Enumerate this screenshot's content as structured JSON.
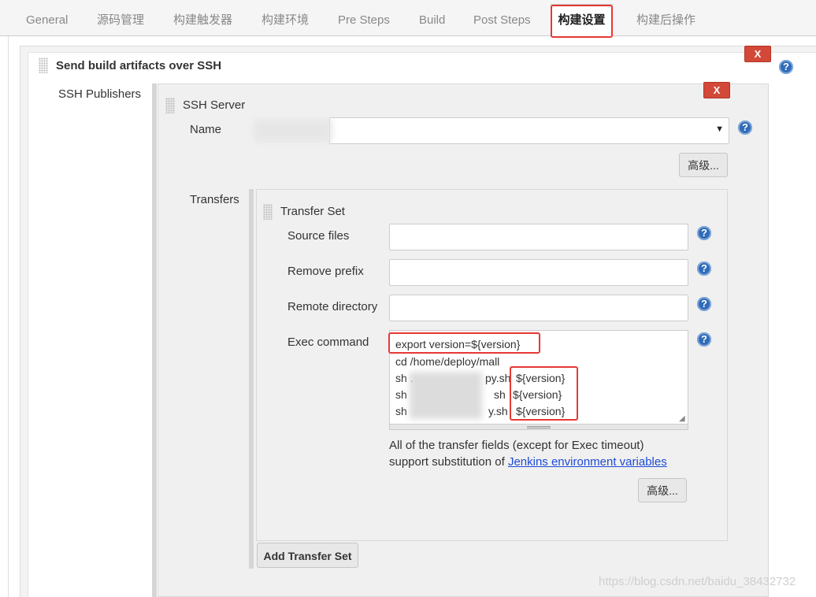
{
  "tabs": [
    {
      "label": "General"
    },
    {
      "label": "源码管理"
    },
    {
      "label": "构建触发器"
    },
    {
      "label": "构建环境"
    },
    {
      "label": "Pre Steps"
    },
    {
      "label": "Build"
    },
    {
      "label": "Post Steps"
    },
    {
      "label": "构建设置"
    },
    {
      "label": "构建后操作"
    }
  ],
  "section": {
    "title": "Send build artifacts over SSH",
    "delete_label": "X",
    "help": "?"
  },
  "publishers": {
    "label": "SSH Publishers",
    "server_title": "SSH Server",
    "delete_label": "X",
    "name_label": "Name",
    "name_value": "",
    "advanced_label": "高级...",
    "transfers_label": "Transfers"
  },
  "transfer_set": {
    "title": "Transfer Set",
    "source_files_label": "Source files",
    "source_files_value": "",
    "remove_prefix_label": "Remove prefix",
    "remove_prefix_value": "",
    "remote_directory_label": "Remote directory",
    "remote_directory_value": "",
    "exec_command_label": "Exec command",
    "exec_lines": [
      "export version=${version}",
      "cd /home/deploy/mall",
      "sh .",
      "py.sh",
      "${version}",
      "sh",
      "sh",
      "${version}",
      "sh",
      "y.sh",
      "${version}"
    ],
    "note_line1": "All of the transfer fields (except for Exec timeout)",
    "note_prefix": "support substitution of ",
    "note_link": "Jenkins environment variables",
    "advanced_label": "高级...",
    "add_label": "Add Transfer Set"
  },
  "watermark": "https://blog.csdn.net/baidu_38432732",
  "colors": {
    "accent_red": "#e53935",
    "delete_red": "#d24939",
    "help_blue": "#2f6bb8",
    "link_blue": "#1e4bd6"
  }
}
